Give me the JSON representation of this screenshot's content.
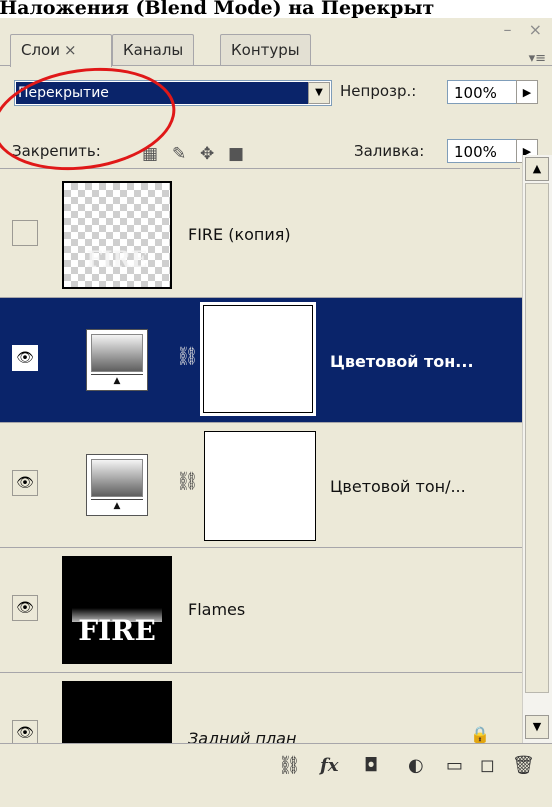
{
  "caption": "им Наложения (Blend Mode) на Перекрыт",
  "window": {
    "minimize_glyph": "–",
    "close_glyph": "×"
  },
  "tabs": [
    {
      "label": "Слои",
      "close": "×",
      "active": true
    },
    {
      "label": "Каналы",
      "active": false
    },
    {
      "label": "Контуры",
      "active": false
    }
  ],
  "panel_menu_glyph": "▾≡",
  "blend_mode": {
    "value": "Перекрытие"
  },
  "opacity": {
    "label": "Непрозр.:",
    "value": "100%"
  },
  "lock": {
    "label": "Закрепить:"
  },
  "fill": {
    "label": "Заливка:",
    "value": "100%"
  },
  "layers": [
    {
      "name": "FIRE (копия)",
      "visible": false,
      "selected": false,
      "kind": "transparent",
      "thumb_text": "FIRE"
    },
    {
      "name": "Цветовой тон...",
      "visible": true,
      "selected": true,
      "kind": "adjustment"
    },
    {
      "name": "Цветовой тон/...",
      "visible": true,
      "selected": false,
      "kind": "adjustment"
    },
    {
      "name": "Flames",
      "visible": true,
      "selected": false,
      "kind": "fire",
      "thumb_text": "FIRE"
    },
    {
      "name": "Задний план",
      "visible": true,
      "selected": false,
      "kind": "background",
      "locked": true
    }
  ],
  "bottom_icons": [
    "link-layers-icon",
    "fx-icon",
    "add-mask-icon",
    "adjustment-layer-icon",
    "new-group-icon",
    "new-layer-icon",
    "trash-icon"
  ],
  "bottom_glyphs": {
    "link": "⛓",
    "fx": "fx",
    "mask": "◘",
    "adj": "◐",
    "group": "▭",
    "new": "◻",
    "trash": "🗑"
  },
  "colors": {
    "panel": "#ece9d8",
    "selection": "#0a246a",
    "annotation": "#e01818"
  }
}
